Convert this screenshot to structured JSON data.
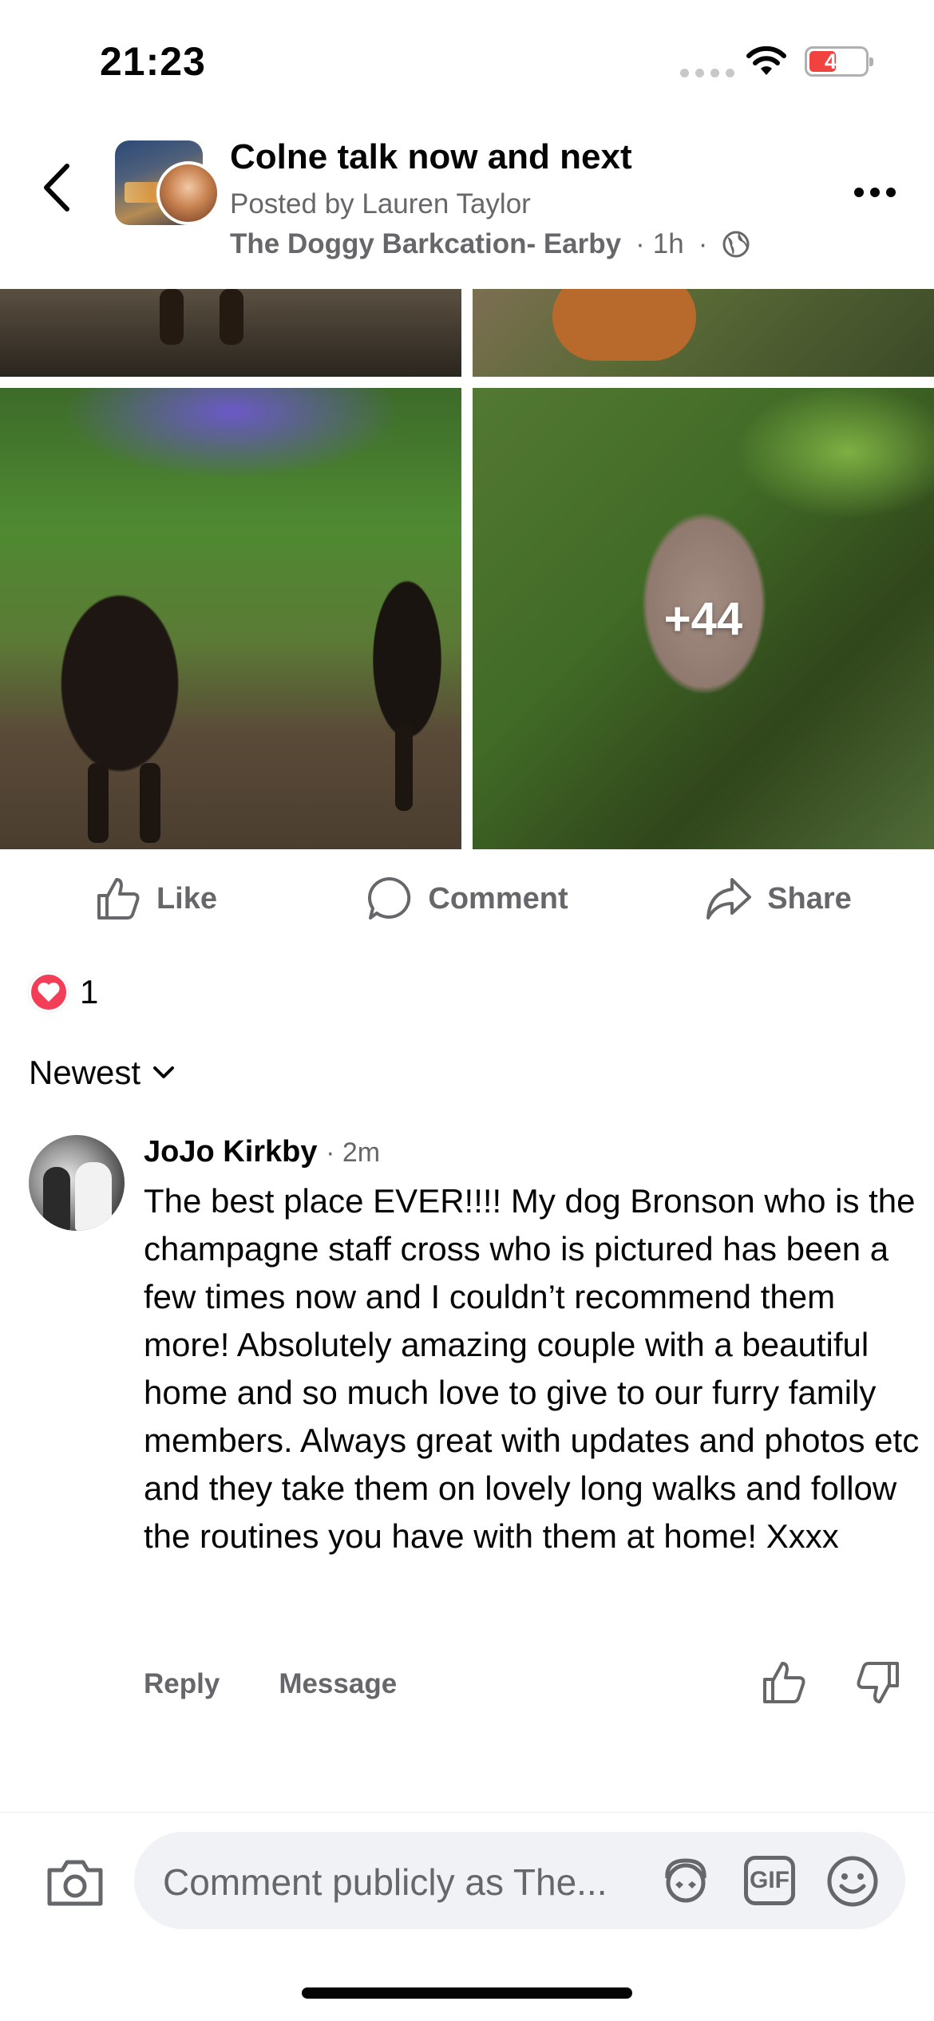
{
  "status_bar": {
    "time": "21:23",
    "battery": "44",
    "battery_level": 0.44,
    "battery_color": "#f0423f"
  },
  "header": {
    "title": "Colne talk now and next",
    "posted_by": "Posted by Lauren Taylor",
    "page_name": "The Doggy Barkcation- Earby",
    "time": "1h",
    "separator": "·",
    "icons": {
      "back": "chevron-left-icon",
      "privacy": "globe-icon",
      "more": "more-options-icon"
    }
  },
  "photos": {
    "more_count": "+44"
  },
  "actions": {
    "like": "Like",
    "comment": "Comment",
    "share": "Share",
    "icons": {
      "like": "thumbs-up-icon",
      "comment": "speech-bubble-icon",
      "share": "share-arrow-icon"
    }
  },
  "reactions": {
    "count": "1",
    "type": "heart-icon",
    "color": "#f33e58"
  },
  "sort": {
    "label": "Newest"
  },
  "comment": {
    "author": "JoJo Kirkby",
    "time": "· 2m",
    "text": "The best place EVER!!!! My dog Bronson who is the champagne staff cross who is pictured has been a few times now and I couldn’t recommend them more! Absolutely amazing couple with a beautiful home and so much love to give to our furry family members. Always great with updates and photos etc and they take them on lovely long walks and follow the routines you have with them at home! Xxxx",
    "reply": "Reply",
    "message": "Message"
  },
  "composer": {
    "placeholder": "Comment publicly as The...",
    "gif_label": "GIF"
  },
  "colors": {
    "secondary_text": "#65676b",
    "primary_text": "#050505",
    "input_background": "#f0f2f5"
  }
}
